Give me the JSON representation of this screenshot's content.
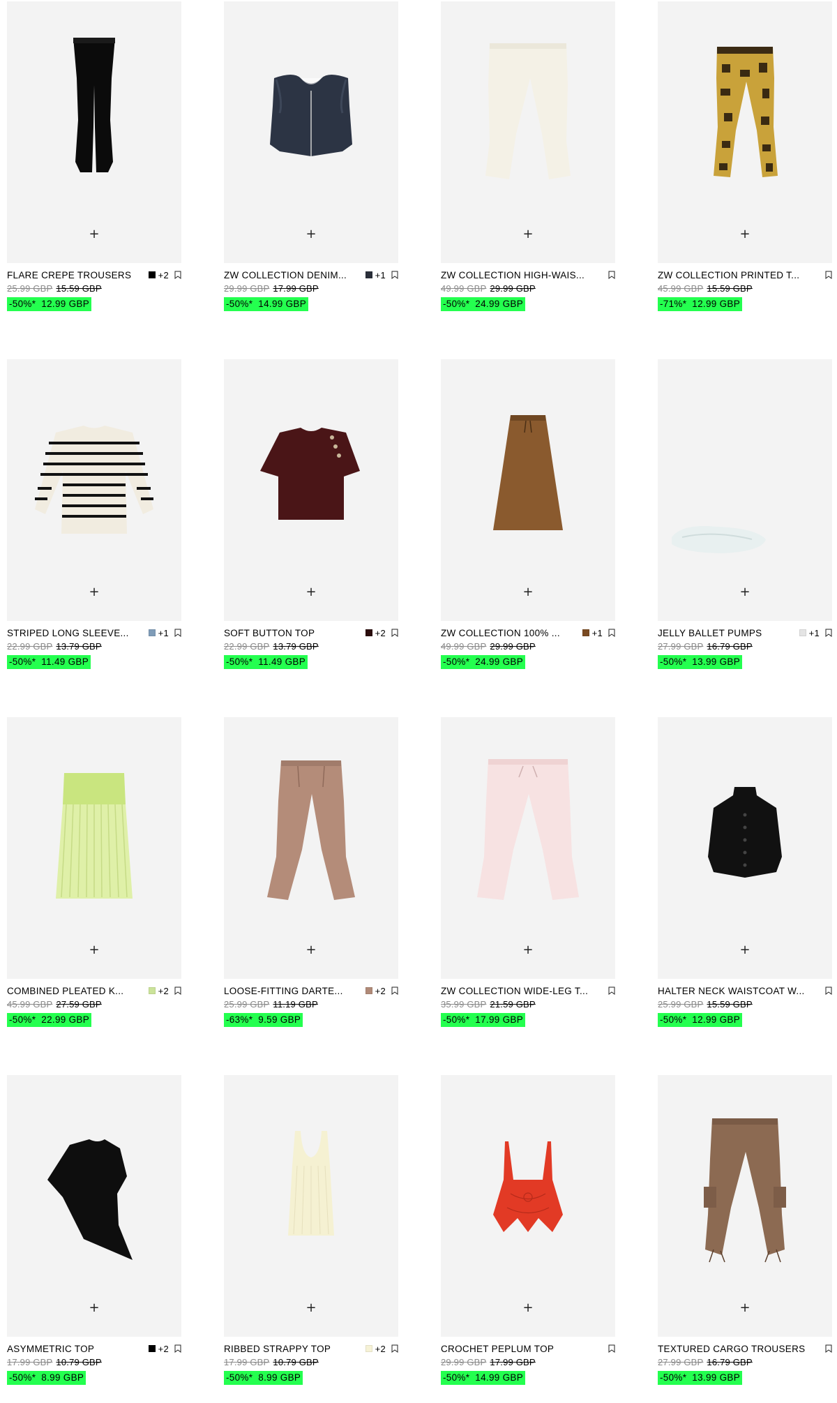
{
  "colors": {
    "sale_highlight": "#24ff4f",
    "image_bg": "#f3f3f3"
  },
  "plus_label": "+",
  "products": [
    {
      "title": "FLARE CREPE TROUSERS",
      "swatch": "#000000",
      "more": "+2",
      "original": "25.99 GBP",
      "previous": "15.59 GBP",
      "discount": "-50%*",
      "price": "12.99 GBP",
      "icon": "flare-trousers-black"
    },
    {
      "title": "ZW COLLECTION DENIM...",
      "swatch": "#2a2f3a",
      "more": "+1",
      "original": "29.99 GBP",
      "previous": "17.99 GBP",
      "discount": "-50%*",
      "price": "14.99 GBP",
      "icon": "denim-waistcoat"
    },
    {
      "title": "ZW COLLECTION HIGH-WAIS...",
      "swatch": "",
      "more": "",
      "original": "49.99 GBP",
      "previous": "29.99 GBP",
      "discount": "-50%*",
      "price": "24.99 GBP",
      "icon": "white-trousers"
    },
    {
      "title": "ZW COLLECTION PRINTED T...",
      "swatch": "",
      "more": "",
      "original": "45.99 GBP",
      "previous": "15.59 GBP",
      "discount": "-71%*",
      "price": "12.99 GBP",
      "icon": "printed-trousers"
    },
    {
      "title": "STRIPED LONG SLEEVE...",
      "swatch": "#7f9cb8",
      "more": "+1",
      "original": "22.99 GBP",
      "previous": "13.79 GBP",
      "discount": "-50%*",
      "price": "11.49 GBP",
      "icon": "striped-top"
    },
    {
      "title": "SOFT BUTTON TOP",
      "swatch": "#2b0d0d",
      "more": "+2",
      "original": "22.99 GBP",
      "previous": "13.79 GBP",
      "discount": "-50%*",
      "price": "11.49 GBP",
      "icon": "button-top"
    },
    {
      "title": "ZW COLLECTION 100% ...",
      "swatch": "#7a4a22",
      "more": "+1",
      "original": "49.99 GBP",
      "previous": "29.99 GBP",
      "discount": "-50%*",
      "price": "24.99 GBP",
      "icon": "brown-skirt"
    },
    {
      "title": "JELLY BALLET PUMPS",
      "swatch": "#e4e4e4",
      "more": "+1",
      "original": "27.99 GBP",
      "previous": "16.79 GBP",
      "discount": "-50%*",
      "price": "13.99 GBP",
      "icon": "jelly-pumps"
    },
    {
      "title": "COMBINED PLEATED K...",
      "swatch": "#cbe39a",
      "more": "+2",
      "original": "45.99 GBP",
      "previous": "27.59 GBP",
      "discount": "-50%*",
      "price": "22.99 GBP",
      "icon": "pleated-skirt"
    },
    {
      "title": "LOOSE-FITTING DARTE...",
      "swatch": "#b08a78",
      "more": "+2",
      "original": "25.99 GBP",
      "previous": "11.19 GBP",
      "discount": "-63%*",
      "price": "9.59 GBP",
      "icon": "darted-trousers"
    },
    {
      "title": "ZW COLLECTION WIDE-LEG T...",
      "swatch": "",
      "more": "",
      "original": "35.99 GBP",
      "previous": "21.59 GBP",
      "discount": "-50%*",
      "price": "17.99 GBP",
      "icon": "pink-trousers"
    },
    {
      "title": "HALTER NECK WAISTCOAT W...",
      "swatch": "",
      "more": "",
      "original": "25.99 GBP",
      "previous": "15.59 GBP",
      "discount": "-50%*",
      "price": "12.99 GBP",
      "icon": "halter-waistcoat"
    },
    {
      "title": "ASYMMETRIC TOP",
      "swatch": "#000000",
      "more": "+2",
      "original": "17.99 GBP",
      "previous": "10.79 GBP",
      "discount": "-50%*",
      "price": "8.99 GBP",
      "icon": "asymmetric-top"
    },
    {
      "title": "RIBBED STRAPPY TOP",
      "swatch": "#f6f2d6",
      "more": "+2",
      "original": "17.99 GBP",
      "previous": "10.79 GBP",
      "discount": "-50%*",
      "price": "8.99 GBP",
      "icon": "ribbed-top"
    },
    {
      "title": "CROCHET PEPLUM TOP",
      "swatch": "",
      "more": "",
      "original": "29.99 GBP",
      "previous": "17.99 GBP",
      "discount": "-50%*",
      "price": "14.99 GBP",
      "icon": "crochet-top"
    },
    {
      "title": "TEXTURED CARGO TROUSERS",
      "swatch": "",
      "more": "",
      "original": "27.99 GBP",
      "previous": "16.79 GBP",
      "discount": "-50%*",
      "price": "13.99 GBP",
      "icon": "cargo-trousers"
    }
  ]
}
